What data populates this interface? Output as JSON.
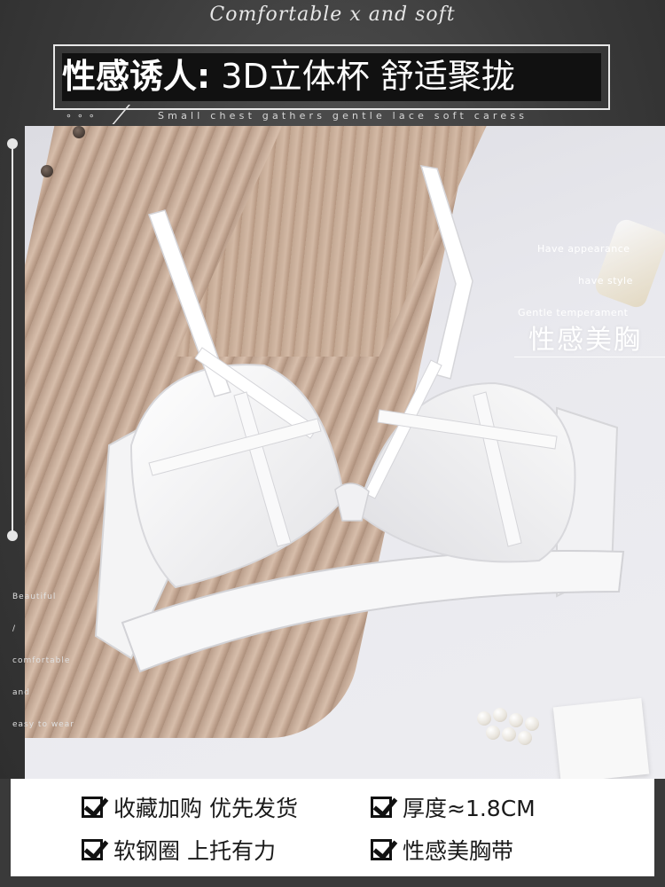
{
  "header": {
    "script_title": "Comfortable x and soft",
    "headline_bold": "性感诱人:",
    "headline_light": "3D立体杯 舒适聚拢",
    "dots": "∘∘∘",
    "subline": "Small chest gathers gentle lace soft caress"
  },
  "overlay": {
    "title": "性感美胸",
    "lines": [
      "Have appearance",
      "have style",
      "Gentle temperament"
    ]
  },
  "side": {
    "lines": [
      "Beautiful",
      "/",
      "comfortable",
      "and",
      "easy to wear"
    ]
  },
  "features": [
    {
      "label": "收藏加购 优先发货"
    },
    {
      "label": "厚度≈1.8CM"
    },
    {
      "label": "软钢圈 上托有力"
    },
    {
      "label": "性感美胸带"
    }
  ],
  "colors": {
    "background": "#3a3a3a",
    "banner": "#111111",
    "text_light": "#ffffff",
    "text_dark": "#1a1a1a"
  },
  "icons": {
    "check": "checkbox-check-icon"
  }
}
